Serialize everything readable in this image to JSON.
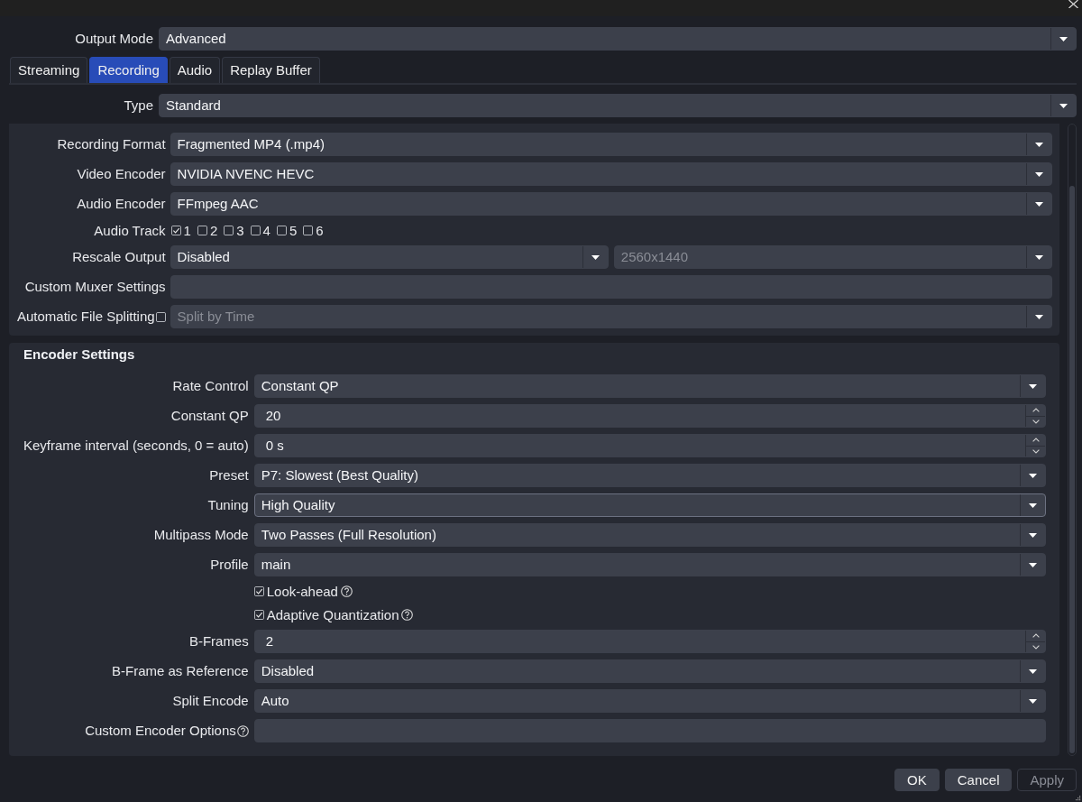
{
  "output_mode": {
    "kind": "field",
    "label": "Output Mode",
    "fields": [
      {
        "kind": "combo",
        "value": "Advanced",
        "disabled": false,
        "focused": false
      }
    ]
  },
  "tabs": [
    {
      "label": "Streaming",
      "selected": false
    },
    {
      "label": "Recording",
      "selected": true
    },
    {
      "label": "Audio",
      "selected": false
    },
    {
      "label": "Replay Buffer",
      "selected": false
    }
  ],
  "type": {
    "kind": "field",
    "label": "Type",
    "fields": [
      {
        "kind": "combo",
        "value": "Standard",
        "disabled": false,
        "focused": false
      }
    ]
  },
  "recording_settings": {
    "rows": [
      {
        "kind": "field",
        "label": "Recording Format",
        "fields": [
          {
            "kind": "combo",
            "value": "Fragmented MP4 (.mp4)",
            "disabled": false,
            "focused": false
          }
        ]
      },
      {
        "kind": "field",
        "label": "Video Encoder",
        "fields": [
          {
            "kind": "combo",
            "value": "NVIDIA NVENC HEVC",
            "disabled": false,
            "focused": false
          }
        ]
      },
      {
        "kind": "field",
        "label": "Audio Encoder",
        "fields": [
          {
            "kind": "combo",
            "value": "FFmpeg AAC",
            "disabled": false,
            "focused": false
          }
        ]
      },
      {
        "kind": "tracks",
        "label": "Audio Track",
        "tracks": [
          {
            "label": "1",
            "checked": true
          },
          {
            "label": "2",
            "checked": false
          },
          {
            "label": "3",
            "checked": false
          },
          {
            "label": "4",
            "checked": false
          },
          {
            "label": "5",
            "checked": false
          },
          {
            "label": "6",
            "checked": false
          }
        ]
      },
      {
        "kind": "field",
        "label": "Rescale Output",
        "fields": [
          {
            "kind": "combo",
            "value": "Disabled",
            "disabled": false,
            "focused": false
          },
          {
            "kind": "combo",
            "value": "2560x1440",
            "disabled": true,
            "focused": false
          }
        ]
      },
      {
        "kind": "field",
        "label": "Custom Muxer Settings",
        "fields": [
          {
            "kind": "text",
            "disabled": false,
            "focused": false
          }
        ]
      },
      {
        "kind": "field",
        "label": "Automatic File Splitting",
        "checkbox": {
          "checked": false
        },
        "fields": [
          {
            "kind": "combo",
            "value": "Split by Time",
            "disabled": true,
            "focused": false
          }
        ]
      }
    ]
  },
  "encoder_settings": {
    "title": "Encoder Settings",
    "rows": [
      {
        "kind": "field",
        "label": "Rate Control",
        "fields": [
          {
            "kind": "combo",
            "value": "Constant QP",
            "disabled": false,
            "focused": false
          }
        ]
      },
      {
        "kind": "field",
        "label": "Constant QP",
        "fields": [
          {
            "kind": "spin",
            "value": "20",
            "disabled": false,
            "focused": false
          }
        ]
      },
      {
        "kind": "field",
        "label": "Keyframe interval (seconds, 0 = auto)",
        "fields": [
          {
            "kind": "spin",
            "value": "0 s",
            "disabled": false,
            "focused": false
          }
        ]
      },
      {
        "kind": "field",
        "label": "Preset",
        "fields": [
          {
            "kind": "combo",
            "value": "P7: Slowest (Best Quality)",
            "disabled": false,
            "focused": false
          }
        ]
      },
      {
        "kind": "field",
        "label": "Tuning",
        "fields": [
          {
            "kind": "combo",
            "value": "High Quality",
            "disabled": false,
            "focused": true
          }
        ]
      },
      {
        "kind": "field",
        "label": "Multipass Mode",
        "fields": [
          {
            "kind": "combo",
            "value": "Two Passes (Full Resolution)",
            "disabled": false,
            "focused": false
          }
        ]
      },
      {
        "kind": "field",
        "label": "Profile",
        "fields": [
          {
            "kind": "combo",
            "value": "main",
            "disabled": false,
            "focused": false
          }
        ]
      },
      {
        "kind": "check",
        "label": "Look-ahead",
        "checked": true,
        "help": true
      },
      {
        "kind": "check",
        "label": "Adaptive Quantization",
        "checked": true,
        "help": true
      },
      {
        "kind": "field",
        "label": "B-Frames",
        "fields": [
          {
            "kind": "spin",
            "value": "2",
            "disabled": false,
            "focused": false
          }
        ]
      },
      {
        "kind": "field",
        "label": "B-Frame as Reference",
        "fields": [
          {
            "kind": "combo",
            "value": "Disabled",
            "disabled": false,
            "focused": false
          }
        ]
      },
      {
        "kind": "field",
        "label": "Split Encode",
        "fields": [
          {
            "kind": "combo",
            "value": "Auto",
            "disabled": false,
            "focused": false
          }
        ]
      },
      {
        "kind": "field",
        "label": "Custom Encoder Options",
        "help": true,
        "fields": [
          {
            "kind": "text",
            "disabled": false,
            "focused": false
          }
        ]
      }
    ]
  },
  "buttons": [
    {
      "label": "OK",
      "disabled": false
    },
    {
      "label": "Cancel",
      "disabled": false
    },
    {
      "label": "Apply",
      "disabled": true
    }
  ]
}
